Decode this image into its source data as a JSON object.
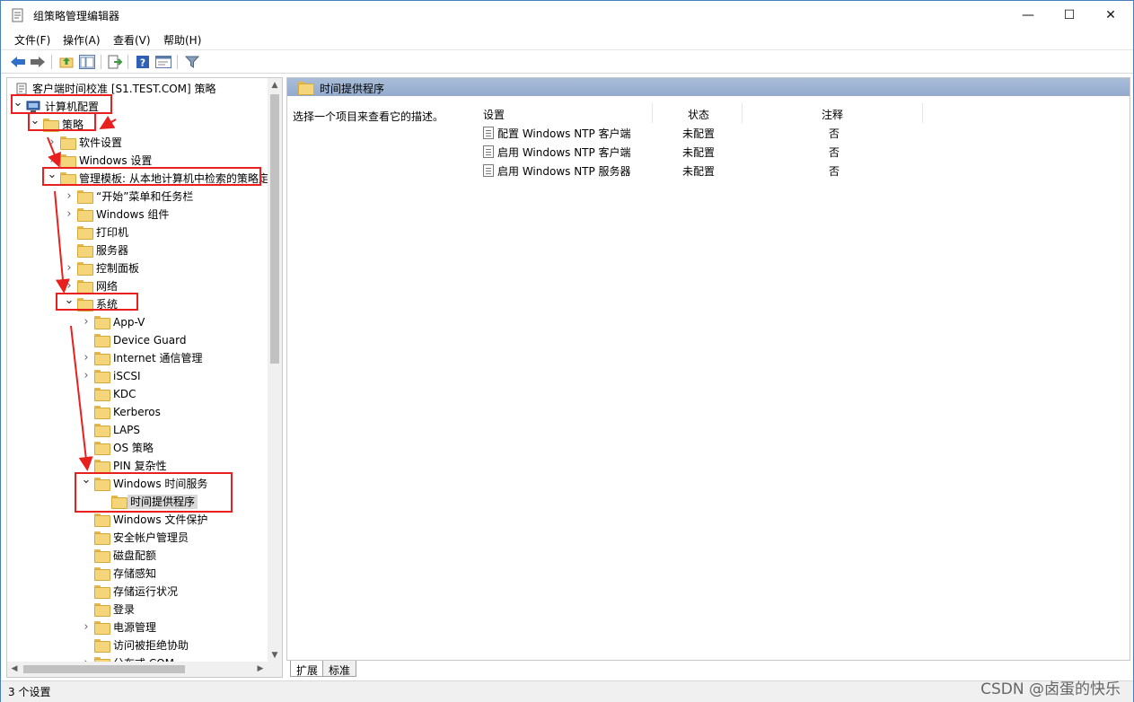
{
  "window": {
    "title": "组策略管理编辑器",
    "minimize_glyph": "—",
    "maximize_glyph": "☐",
    "close_glyph": "✕"
  },
  "menu": [
    "文件(F)",
    "操作(A)",
    "查看(V)",
    "帮助(H)"
  ],
  "toolbar": {
    "icons": [
      "back-icon",
      "forward-icon",
      "up-folder-icon",
      "show-tree-icon",
      "export-list-icon",
      "help-icon",
      "properties-icon",
      "filter-icon"
    ]
  },
  "tree": {
    "root_label": "客户端时间校准 [S1.TEST.COM] 策略",
    "items": [
      {
        "label": "计算机配置",
        "expanded": true,
        "has_children": true
      },
      {
        "label": "策略",
        "expanded": true,
        "has_children": true
      },
      {
        "label": "软件设置",
        "expanded": false,
        "has_children": true
      },
      {
        "label": "Windows 设置",
        "expanded": false,
        "has_children": true
      },
      {
        "label": "管理模板: 从本地计算机中检索的策略定",
        "expanded": true,
        "has_children": true
      },
      {
        "label": "“开始”菜单和任务栏",
        "expanded": false,
        "has_children": true
      },
      {
        "label": "Windows 组件",
        "expanded": false,
        "has_children": true
      },
      {
        "label": "打印机",
        "expanded": false,
        "has_children": false
      },
      {
        "label": "服务器",
        "expanded": false,
        "has_children": false
      },
      {
        "label": "控制面板",
        "expanded": false,
        "has_children": true
      },
      {
        "label": "网络",
        "expanded": false,
        "has_children": true
      },
      {
        "label": "系统",
        "expanded": true,
        "has_children": true
      },
      {
        "label": "App-V",
        "expanded": false,
        "has_children": true
      },
      {
        "label": "Device Guard",
        "expanded": false,
        "has_children": false
      },
      {
        "label": "Internet 通信管理",
        "expanded": false,
        "has_children": true
      },
      {
        "label": "iSCSI",
        "expanded": false,
        "has_children": true
      },
      {
        "label": "KDC",
        "expanded": false,
        "has_children": false
      },
      {
        "label": "Kerberos",
        "expanded": false,
        "has_children": false
      },
      {
        "label": "LAPS",
        "expanded": false,
        "has_children": false
      },
      {
        "label": "OS 策略",
        "expanded": false,
        "has_children": false
      },
      {
        "label": "PIN 复杂性",
        "expanded": false,
        "has_children": false
      },
      {
        "label": "Windows 时间服务",
        "expanded": true,
        "has_children": true
      },
      {
        "label": "时间提供程序",
        "expanded": false,
        "has_children": false,
        "selected": true
      },
      {
        "label": "Windows 文件保护",
        "expanded": false,
        "has_children": false
      },
      {
        "label": "安全帐户管理员",
        "expanded": false,
        "has_children": false
      },
      {
        "label": "磁盘配额",
        "expanded": false,
        "has_children": false
      },
      {
        "label": "存储感知",
        "expanded": false,
        "has_children": false
      },
      {
        "label": "存储运行状况",
        "expanded": false,
        "has_children": false
      },
      {
        "label": "登录",
        "expanded": false,
        "has_children": false
      },
      {
        "label": "电源管理",
        "expanded": false,
        "has_children": true
      },
      {
        "label": "访问被拒绝协助",
        "expanded": false,
        "has_children": false
      },
      {
        "label": "分布式 COM",
        "expanded": false,
        "has_children": true
      }
    ]
  },
  "right_pane": {
    "header": "时间提供程序",
    "description": "选择一个项目来查看它的描述。",
    "columns": [
      "设置",
      "状态",
      "注释"
    ],
    "rows": [
      {
        "setting": "配置 Windows NTP 客户端",
        "state": "未配置",
        "comment": "否"
      },
      {
        "setting": "启用 Windows NTP 客户端",
        "state": "未配置",
        "comment": "否"
      },
      {
        "setting": "启用 Windows NTP 服务器",
        "state": "未配置",
        "comment": "否"
      }
    ]
  },
  "tabs": [
    "扩展",
    "标准"
  ],
  "status": {
    "text": "3 个设置",
    "watermark": "CSDN @卤蛋的快乐"
  },
  "colors": {
    "annotation": "#e8201e",
    "header_blue": "#a9bdd8",
    "folder": "#f4d57a"
  }
}
